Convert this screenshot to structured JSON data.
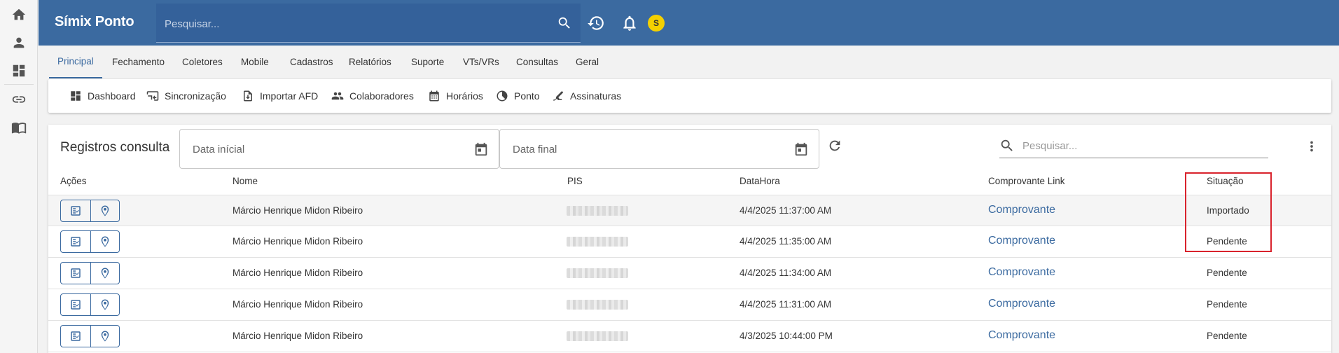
{
  "header": {
    "app_title": "Símix Ponto",
    "search_placeholder": "Pesquisar...",
    "avatar_initial": "S"
  },
  "menu": {
    "tabs": [
      {
        "label": "Principal",
        "active": true
      },
      {
        "label": "Fechamento"
      },
      {
        "label": "Coletores"
      },
      {
        "label": "Mobile"
      },
      {
        "label": "Cadastros"
      },
      {
        "label": "Relatórios"
      },
      {
        "label": "Suporte"
      },
      {
        "label": "VTs/VRs"
      },
      {
        "label": "Consultas"
      },
      {
        "label": "Geral"
      }
    ]
  },
  "subbar": {
    "items": [
      {
        "label": "Dashboard",
        "icon": "dashboard-icon"
      },
      {
        "label": "Sincronização",
        "icon": "sync-icon"
      },
      {
        "label": "Importar AFD",
        "icon": "import-icon"
      },
      {
        "label": "Colaboradores",
        "icon": "people-icon"
      },
      {
        "label": "Horários",
        "icon": "calendar-grid-icon"
      },
      {
        "label": "Ponto",
        "icon": "clock-half-icon"
      },
      {
        "label": "Assinaturas",
        "icon": "signature-icon"
      }
    ]
  },
  "card": {
    "title": "Registros consulta",
    "date_start_label": "Data inícial",
    "date_end_label": "Data final",
    "search_placeholder": "Pesquisar..."
  },
  "table": {
    "columns": {
      "acoes": "Ações",
      "nome": "Nome",
      "pis": "PIS",
      "datahora": "DataHora",
      "comprovante": "Comprovante Link",
      "situacao": "Situação"
    },
    "rows": [
      {
        "nome": "Márcio Henrique Midon Ribeiro",
        "datahora": "4/4/2025 11:37:00 AM",
        "comprovante": "Comprovante",
        "situacao": "Importado"
      },
      {
        "nome": "Márcio Henrique Midon Ribeiro",
        "datahora": "4/4/2025 11:35:00 AM",
        "comprovante": "Comprovante",
        "situacao": "Pendente"
      },
      {
        "nome": "Márcio Henrique Midon Ribeiro",
        "datahora": "4/4/2025 11:34:00 AM",
        "comprovante": "Comprovante",
        "situacao": "Pendente"
      },
      {
        "nome": "Márcio Henrique Midon Ribeiro",
        "datahora": "4/4/2025 11:31:00 AM",
        "comprovante": "Comprovante",
        "situacao": "Pendente"
      },
      {
        "nome": "Márcio Henrique Midon Ribeiro",
        "datahora": "4/3/2025 10:44:00 PM",
        "comprovante": "Comprovante",
        "situacao": "Pendente"
      }
    ]
  },
  "colors": {
    "header_bg": "#3b6aa0",
    "accent": "#3b6aa0",
    "avatar": "#f4d000",
    "highlight": "#d9232d"
  }
}
